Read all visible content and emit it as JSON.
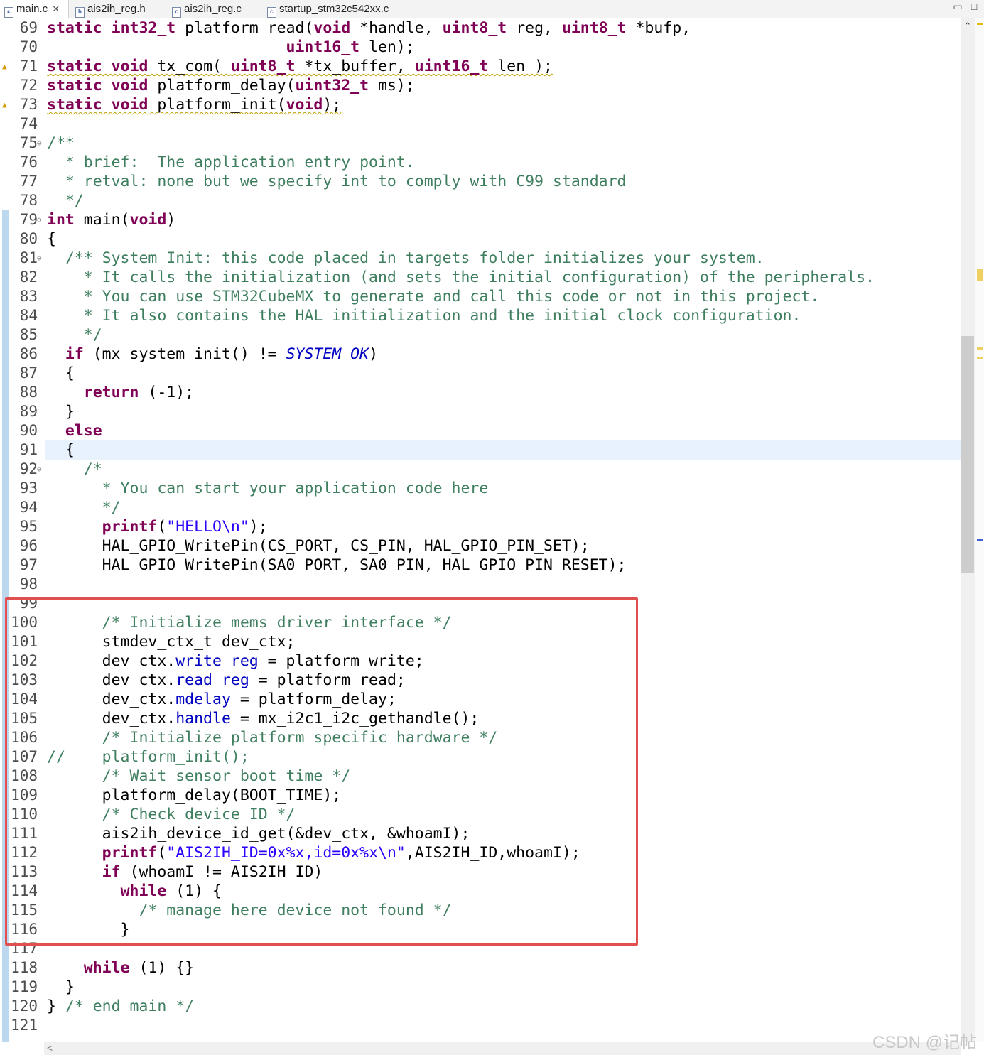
{
  "tabs": [
    {
      "icon": "c",
      "label": "main.c",
      "close": "✕"
    },
    {
      "icon": "h",
      "label": "ais2ih_reg.h"
    },
    {
      "icon": "c",
      "label": "ais2ih_reg.c"
    },
    {
      "icon": "c",
      "label": "startup_stm32c542xx.c"
    }
  ],
  "window": {
    "minimize": "▭",
    "maximize": "□"
  },
  "line_numbers": [
    "69",
    "70",
    "71",
    "72",
    "73",
    "74",
    "75",
    "76",
    "77",
    "78",
    "79",
    "80",
    "81",
    "82",
    "83",
    "84",
    "85",
    "86",
    "87",
    "88",
    "89",
    "90",
    "91",
    "92",
    "93",
    "94",
    "95",
    "96",
    "97",
    "98",
    "99",
    "100",
    "101",
    "102",
    "103",
    "104",
    "105",
    "106",
    "107",
    "108",
    "109",
    "110",
    "111",
    "112",
    "113",
    "114",
    "115",
    "116",
    "117",
    "118",
    "119",
    "120",
    "121"
  ],
  "code": {
    "l69": [
      "static",
      " ",
      "int32_t",
      " platform_read(",
      "void",
      " *handle, ",
      "uint8_t",
      " reg, ",
      "uint8_t",
      " *bufp,"
    ],
    "l70": [
      "                          ",
      "uint16_t",
      " len);"
    ],
    "l71": [
      "static",
      " ",
      "void",
      " tx_com( ",
      "uint8_t",
      " *tx_buffer, ",
      "uint16_t",
      " len );"
    ],
    "l72": [
      "static",
      " ",
      "void",
      " platform_delay(",
      "uint32_t",
      " ms);"
    ],
    "l73": [
      "static",
      " ",
      "void",
      " platform_init(",
      "void",
      ");"
    ],
    "l75": "/**",
    "l76": "  * brief:  The application entry point.",
    "l77": "  * retval: none but we specify int to comply with C99 standard",
    "l78": "  */",
    "l79": [
      "int",
      " main(",
      "void",
      ")"
    ],
    "l80": "{",
    "l81": "  /** System Init: this code placed in targets folder initializes your system.",
    "l82": "    * It calls the initialization (and sets the initial configuration) of the peripherals.",
    "l83": "    * You can use STM32CubeMX to generate and call this code or not in this project.",
    "l84": "    * It also contains the HAL initialization and the initial clock configuration.",
    "l85": "    */",
    "l86": [
      "  ",
      "if",
      " (mx_system_init() != ",
      "SYSTEM_OK",
      ")"
    ],
    "l87": "  {",
    "l88": [
      "    ",
      "return",
      " (-1);"
    ],
    "l89": "  }",
    "l90": [
      "  ",
      "else"
    ],
    "l91": "  {",
    "l92": "    /*",
    "l93": "      * You can start your application code here",
    "l94": "      */",
    "l95": [
      "      ",
      "printf",
      "(",
      "\"HELLO\\n\"",
      ");"
    ],
    "l96": "      HAL_GPIO_WritePin(CS_PORT, CS_PIN, HAL_GPIO_PIN_SET);",
    "l97": "      HAL_GPIO_WritePin(SA0_PORT, SA0_PIN, HAL_GPIO_PIN_RESET);",
    "l100": "      /* Initialize mems driver interface */",
    "l101": "      stmdev_ctx_t dev_ctx;",
    "l102": [
      "      dev_ctx.",
      "write_reg",
      " = platform_write;"
    ],
    "l103": [
      "      dev_ctx.",
      "read_reg",
      " = platform_read;"
    ],
    "l104": [
      "      dev_ctx.",
      "mdelay",
      " = platform_delay;"
    ],
    "l105": [
      "      dev_ctx.",
      "handle",
      " = mx_i2c1_i2c_gethandle();"
    ],
    "l106": "      /* Initialize platform specific hardware */",
    "l107": [
      "//",
      "    platform_init();"
    ],
    "l108": "      /* Wait sensor boot time */",
    "l109": "      platform_delay(BOOT_TIME);",
    "l110": "      /* Check device ID */",
    "l111": "      ais2ih_device_id_get(&dev_ctx, &whoamI);",
    "l112": [
      "      ",
      "printf",
      "(",
      "\"AIS2IH_ID=0x%x,id=0x%x\\n\"",
      ",AIS2IH_ID,whoamI);"
    ],
    "l113": [
      "      ",
      "if",
      " (whoamI != AIS2IH_ID)"
    ],
    "l114": [
      "        ",
      "while",
      " (1) {"
    ],
    "l115": "          /* manage here device not found */",
    "l116": "        }",
    "l118": [
      "    ",
      "while",
      " (1) {}"
    ],
    "l119": "  }",
    "l120": [
      "} ",
      "/* end main */"
    ]
  },
  "watermark": "CSDN @记帖",
  "colors": {
    "keyword": "#7f0055",
    "comment": "#3f7f5f",
    "string": "#2a00ff",
    "field": "#0000c0",
    "highlight_box": "#e05050",
    "current_line": "#e8f2fe"
  }
}
